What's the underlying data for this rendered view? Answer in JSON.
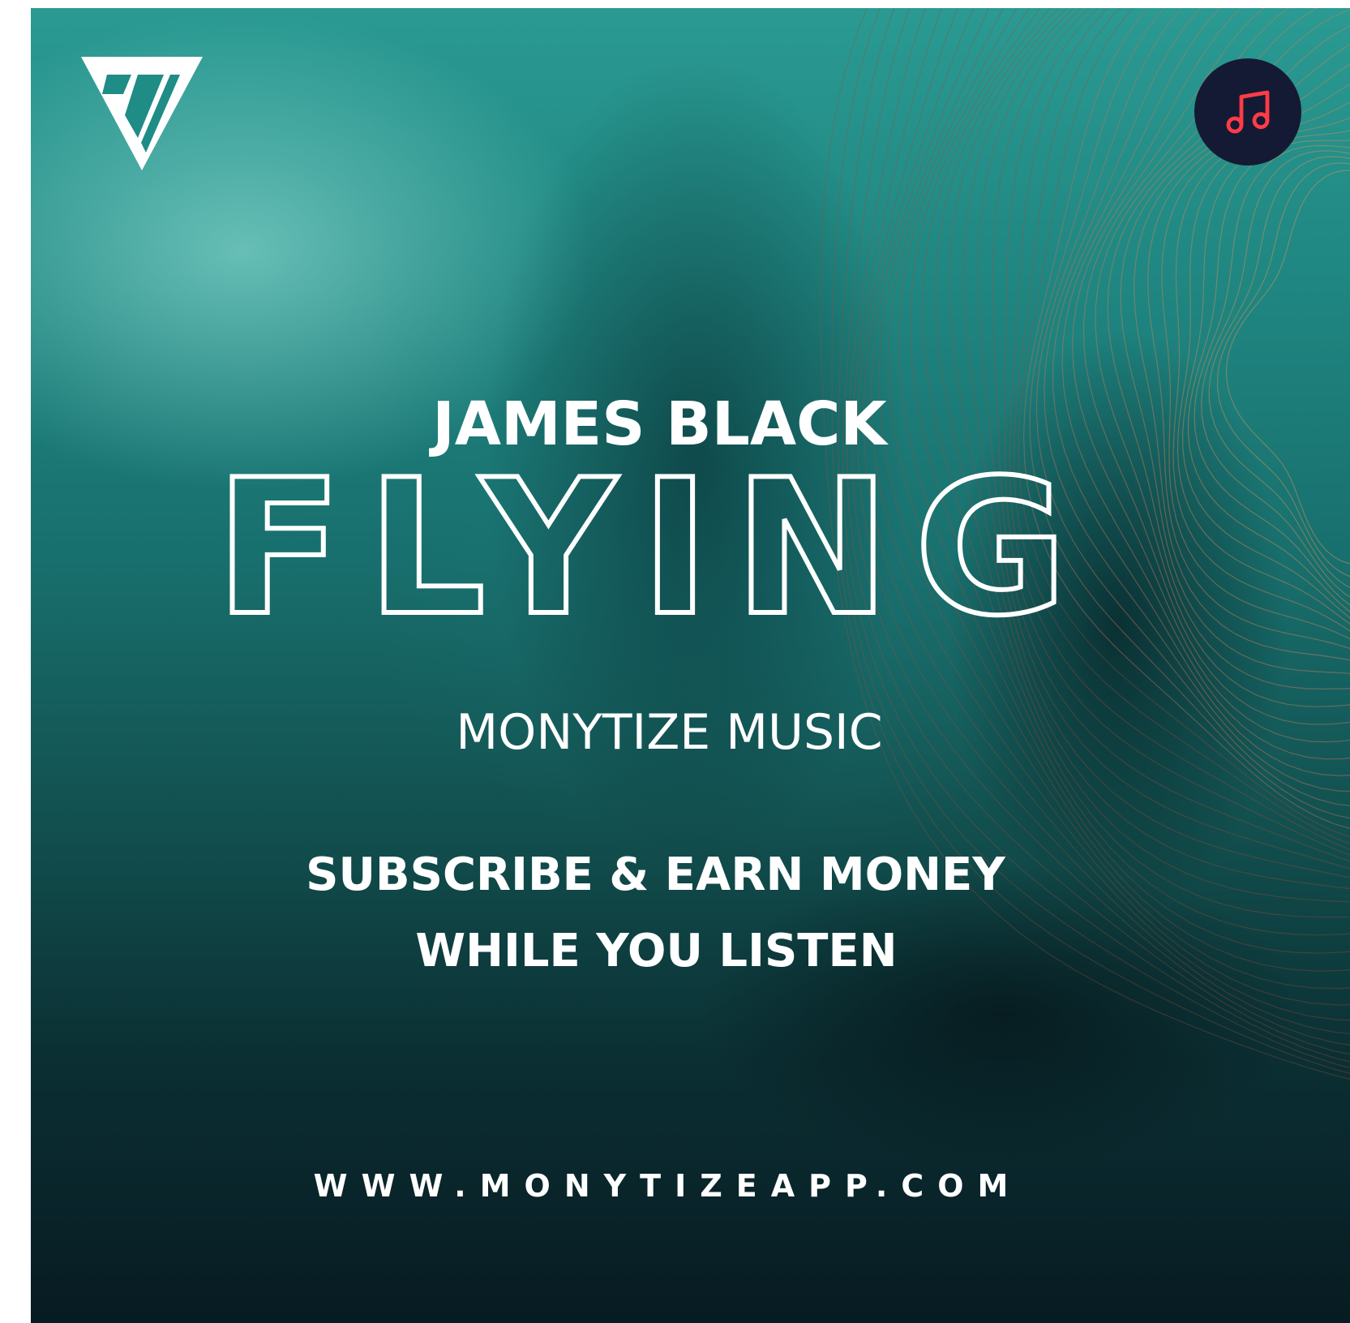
{
  "poster": {
    "artist": "JAMES BLACK",
    "song_title": "FLYING",
    "label": "MONYTIZE MUSIC",
    "tagline_line1": "SUBSCRIBE & EARN MONEY",
    "tagline_line2": "WHILE YOU LISTEN",
    "website": "WWW.MONYTIZEAPP.COM"
  },
  "icons": {
    "logo": "monytize-logo-icon",
    "music": "music-note-icon"
  },
  "colors": {
    "teal_light": "#2a9a92",
    "teal_dark": "#12504f",
    "navy": "#071b22",
    "music_button_bg": "#141a33",
    "music_note": "#ff3b47",
    "text": "#ffffff"
  }
}
